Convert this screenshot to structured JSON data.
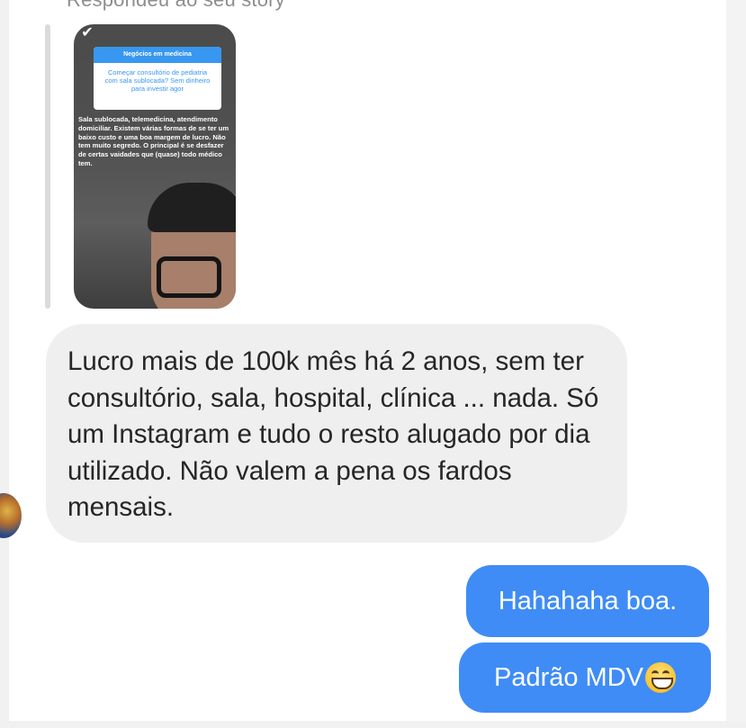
{
  "header": {
    "replied_label": "Respondeu ao seu story"
  },
  "story": {
    "card_title": "Negócios em medicina",
    "card_question": "Começar consultório de pediatria com sala sublocada? Sem dinheiro para investir agor",
    "overlay_text": "Sala sublocada, telemedicina, atendimento domiciliar. Existem várias formas de se ter um baixo custo e uma boa margem de lucro. Não tem muito segredo. O principal é se desfazer de certas vaidades que (quase) todo médico tem."
  },
  "messages": {
    "incoming": "Lucro mais de 100k mês há 2 anos, sem ter consultório, sala, hospital, clínica ... nada. Só um Instagram e tudo o resto alugado por dia utilizado. Não valem a pena os fardos mensais.",
    "outgoing_1": "Hahahaha boa.",
    "outgoing_2": "Padrão MDV"
  },
  "icons": {
    "story_check": "check-icon",
    "emoji": "grinning-face-emoji"
  },
  "colors": {
    "outgoing_bubble": "#3f8cf6",
    "incoming_bubble": "#efefef"
  }
}
